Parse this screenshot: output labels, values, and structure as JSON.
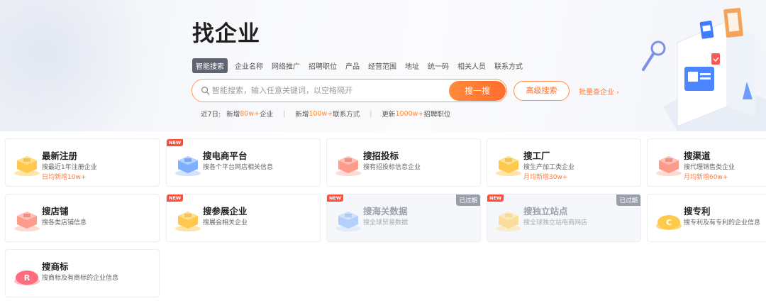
{
  "page_title": "找企业",
  "tabs": [
    {
      "label": "智能搜索",
      "active": true
    },
    {
      "label": "企业名称"
    },
    {
      "label": "网络推广"
    },
    {
      "label": "招聘职位"
    },
    {
      "label": "产品"
    },
    {
      "label": "经营范围"
    },
    {
      "label": "地址"
    },
    {
      "label": "统一码"
    },
    {
      "label": "相关人员"
    },
    {
      "label": "联系方式"
    }
  ],
  "search": {
    "placeholder": "智能搜索，输入任意关键词，以空格隔开",
    "button_label": "搜一搜",
    "advanced_label": "高级搜索",
    "batch_label": "批量查企业 ›"
  },
  "stats": {
    "prefix": "近7日:",
    "s1_pre": "新增",
    "s1_val": "80w+",
    "s1_post": "企业",
    "s2_pre": "新增",
    "s2_val": "100w+",
    "s2_post": "联系方式",
    "s3_pre": "更新",
    "s3_val": "1000w+",
    "s3_post": "招聘职位",
    "separator": "|"
  },
  "badges": {
    "new": "NEW",
    "expired": "已过期"
  },
  "colors": {
    "accent": "#ff7a3b",
    "new_badge": "#ff4d3a",
    "expired_badge": "#9aa0ab"
  },
  "cards": [
    {
      "title": "最新注册",
      "desc": "搜最近1年注册企业",
      "metric": "日均新增10w+",
      "icon": "yellow-box-icon",
      "new": false,
      "expired": false
    },
    {
      "title": "搜电商平台",
      "desc": "搜各个平台网店相关信息",
      "metric": "",
      "icon": "blue-box-icon",
      "new": true,
      "expired": false
    },
    {
      "title": "搜招投标",
      "desc": "搜有招投标信息企业",
      "metric": "",
      "icon": "red-box-icon",
      "new": false,
      "expired": false
    },
    {
      "title": "搜工厂",
      "desc": "搜生产加工类企业",
      "metric": "月均新增30w+",
      "icon": "yellow-box-icon",
      "new": false,
      "expired": false
    },
    {
      "title": "搜渠道",
      "desc": "搜代理销售类企业",
      "metric": "月均新增60w+",
      "icon": "red-box-icon",
      "new": false,
      "expired": false
    },
    {
      "title": "搜店铺",
      "desc": "搜各类店铺信息",
      "metric": "",
      "icon": "red-box-icon",
      "new": false,
      "expired": false
    },
    {
      "title": "搜参展企业",
      "desc": "搜展会相关企业",
      "metric": "",
      "icon": "yellow-box-icon",
      "new": true,
      "expired": false
    },
    {
      "title": "搜海关数据",
      "desc": "搜全球贸易数据",
      "metric": "",
      "icon": "blue-box-icon",
      "new": true,
      "expired": true
    },
    {
      "title": "搜独立站点",
      "desc": "搜全球独立站电商网店",
      "metric": "",
      "icon": "yellow-box-icon",
      "new": true,
      "expired": true
    },
    {
      "title": "搜专利",
      "desc": "搜专利及有专利的企业信息",
      "metric": "",
      "icon": "yellow-coin-icon",
      "new": false,
      "expired": false
    },
    {
      "title": "搜商标",
      "desc": "搜商标及有商标的企业信息",
      "metric": "",
      "icon": "red-coin-icon",
      "new": false,
      "expired": false
    }
  ]
}
